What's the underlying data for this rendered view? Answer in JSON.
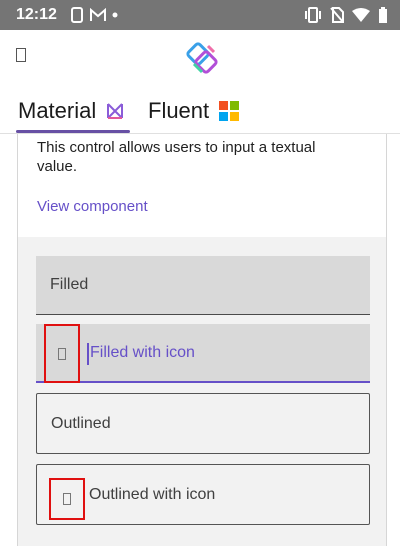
{
  "status_bar": {
    "time": "12:12",
    "left_icons": [
      "screenshot-icon",
      "gmail-icon",
      "dot-icon"
    ],
    "right_icons": [
      "vibrate-icon",
      "no-sim-icon",
      "wifi-icon",
      "battery-icon"
    ]
  },
  "app_bar": {
    "menu_icon": "menu-icon",
    "logo_icon": "uno-platform-logo-icon"
  },
  "tabs": [
    {
      "label": "Material",
      "icon": "material-logo-icon",
      "selected": true
    },
    {
      "label": "Fluent",
      "icon": "windows-logo-icon",
      "selected": false
    }
  ],
  "card": {
    "description": "This control allows users to input a textual value.",
    "link": "View component"
  },
  "fields": {
    "filled": {
      "placeholder": "Filled"
    },
    "filled_icon": {
      "placeholder": "Filled with icon",
      "focused": true
    },
    "outlined": {
      "placeholder": "Outlined"
    },
    "outlined_icon": {
      "placeholder": "Outlined with icon"
    }
  },
  "colors": {
    "accent": "#6650c8",
    "status_bar": "#757575",
    "highlight_box": "#e01010"
  }
}
